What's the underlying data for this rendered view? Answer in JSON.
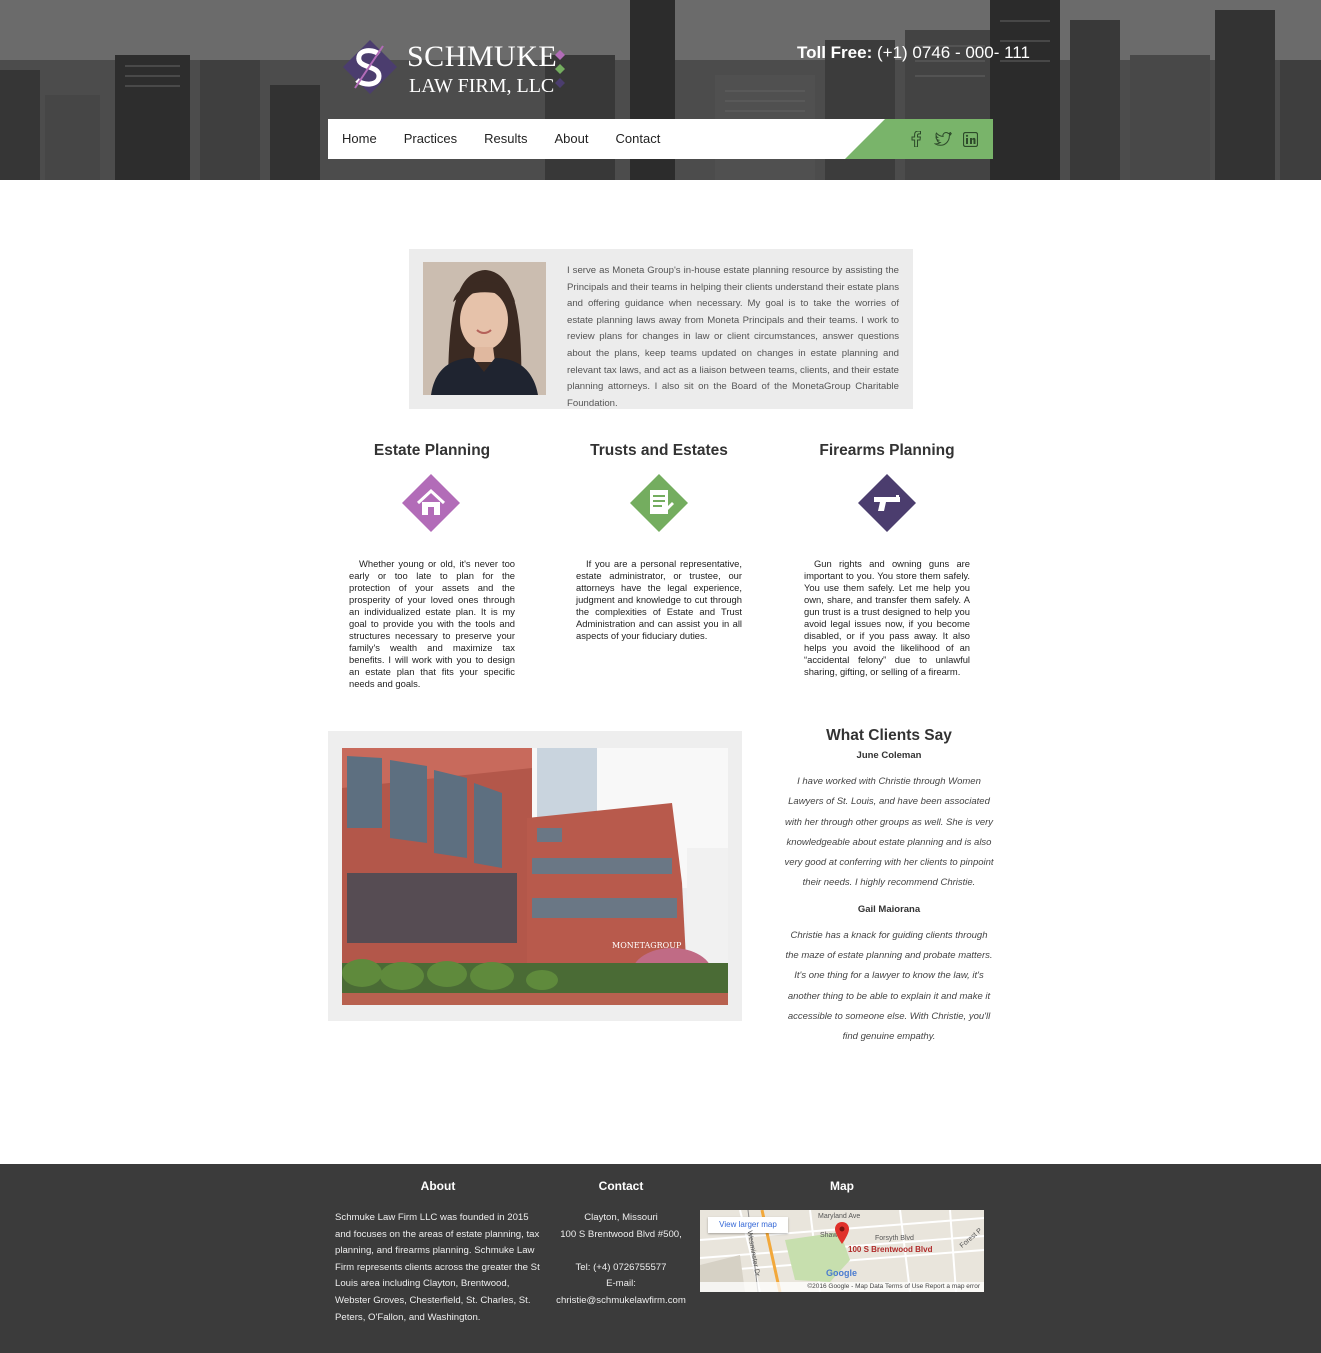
{
  "header": {
    "logo_line1": "SCHMUKE",
    "logo_line2": "LAW FIRM, LLC",
    "toll_free_label": "Toll Free:",
    "toll_free_number": "(+1) 0746 - 000- 111"
  },
  "nav": {
    "items": [
      {
        "label": "Home"
      },
      {
        "label": "Practices"
      },
      {
        "label": "Results"
      },
      {
        "label": "About"
      },
      {
        "label": "Contact"
      }
    ],
    "social": [
      "facebook-icon",
      "twitter-icon",
      "linkedin-icon"
    ]
  },
  "bio": {
    "text": "I serve as Moneta Group's in-house estate planning resource by assisting the Principals and their teams in helping their clients understand their estate plans and offering guidance when necessary. My goal is to take the worries of estate planning laws away from Moneta Principals and their teams. I work to review plans for changes in law or client circumstances, answer questions about the plans, keep teams updated on changes in estate planning and relevant tax laws, and act as a liaison between teams, clients, and their estate planning attorneys. I also sit on the Board of the MonetaGroup Charitable Foundation."
  },
  "practices": [
    {
      "title": "Estate Planning",
      "icon": "house-icon",
      "color": "#b26cb8",
      "text": "Whether young or old, it's never too early or too late to plan for the protection of your assets and the prosperity of your loved ones through an individualized estate plan. It is my goal to provide you with the tools and structures necessary to preserve your family's wealth and maximize tax benefits. I will work with you to design an estate plan that fits your specific needs and goals."
    },
    {
      "title": "Trusts and Estates",
      "icon": "document-icon",
      "color": "#74ad5f",
      "text": "If you are a personal representative, estate administrator, or trustee, our attorneys have the legal experience, judgment and knowledge to cut through the complexities of Estate and Trust Administration and can assist you in all aspects of your fiduciary duties."
    },
    {
      "title": "Firearms Planning",
      "icon": "pistol-icon",
      "color": "#4b3d6e",
      "text": "Gun rights and owning guns are important to you. You store them safely. You use them safely. Let me help you own, share, and transfer them safely. A gun trust is a trust designed to help you avoid legal issues now, if you become disabled, or if you pass away. It also helps you avoid the likelihood of an “accidental felony” due to unlawful sharing, gifting, or selling of a firearm."
    }
  ],
  "photo": {
    "sign": "MONETAGROUP"
  },
  "testimonials": {
    "title": "What Clients Say",
    "items": [
      {
        "name": "June Coleman",
        "quote": "I have worked with Christie through Women Lawyers of St. Louis, and have been associated with her through other groups as well. She is very knowledgeable about estate planning and is also very good at conferring with her clients to pinpoint their needs. I highly recommend Christie."
      },
      {
        "name": "Gail Maiorana",
        "quote": "Christie has a knack for guiding clients through the maze of estate planning and probate matters. It's one thing for a lawyer to know the law, it's another thing to be able to explain it and make it accessible to someone else. With Christie, you'll find genuine empathy."
      }
    ]
  },
  "footer": {
    "about_title": "About",
    "about_text": "Schmuke Law Firm LLC was founded in 2015 and focuses on the areas of estate planning, tax planning, and firearms planning. Schmuke Law Firm represents clients across the greater the St Louis area including Clayton, Brentwood, Webster Groves, Chesterfield, St. Charles, St. Peters, O'Fallon, and Washington.",
    "contact_title": "Contact",
    "contact_city": "Clayton, Missouri",
    "contact_address": "100 S Brentwood Blvd #500,",
    "contact_tel": "Tel: (+4) 0726755577",
    "contact_email_label": "E-mail:",
    "contact_email": "christie@schmukelawfirm.com",
    "map_title": "Map",
    "map_button": "View larger map",
    "map_address": "100 S Brentwood Blvd",
    "map_streets": [
      "Maryland Ave",
      "Forsyth Blvd",
      "Forest P",
      "Wesminster Dr",
      "Shaw"
    ],
    "map_google": "Google",
    "map_attribution": "©2016 Google - Map Data   Terms of Use   Report a map error"
  }
}
